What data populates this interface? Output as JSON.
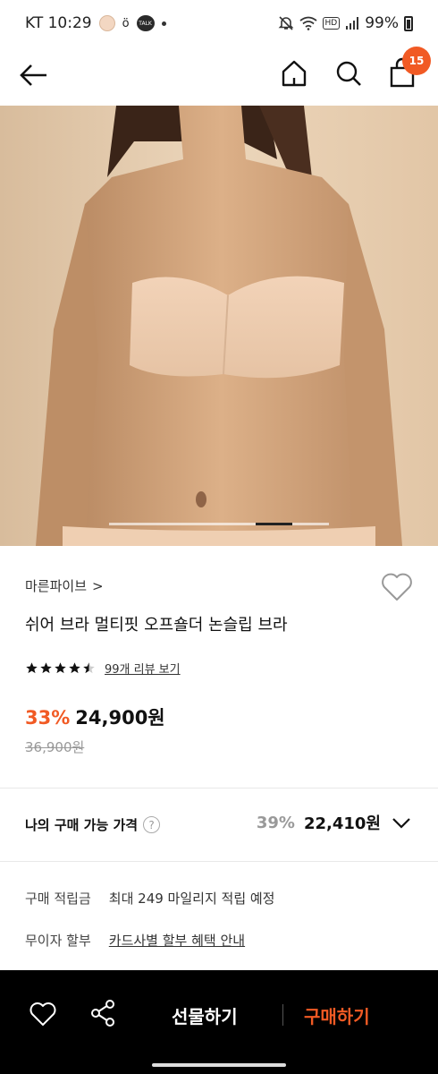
{
  "status_bar": {
    "carrier_time": "KT 10:29",
    "talk_label": "TALK",
    "hd_label": "HD",
    "battery": "99%"
  },
  "nav": {
    "cart_count": "15"
  },
  "carousel": {
    "active_index": 2,
    "total": 6
  },
  "product": {
    "brand": "마른파이브",
    "brand_arrow": ">",
    "title": "쉬어 브라 멀티핏 오프숄더 논슬립 브라",
    "rating": 4.5,
    "review_text": "99개 리뷰 보기",
    "discount": "33%",
    "price": "24,900원",
    "original_price": "36,900원"
  },
  "my_price": {
    "label": "나의 구매 가능 가격",
    "help_glyph": "?",
    "discount": "39%",
    "price": "22,410원"
  },
  "benefits": {
    "points_label": "구매 적립금",
    "points_value": "최대 249 마일리지 적립 예정",
    "installment_label": "무이자 할부",
    "installment_value": "카드사별 할부 혜택 안내"
  },
  "bottom_bar": {
    "gift_label": "선물하기",
    "buy_label": "구매하기"
  },
  "colors": {
    "accent": "#f15a24",
    "skin_bg": "#e7cfb2",
    "bottom_bar_bg": "#000000"
  }
}
